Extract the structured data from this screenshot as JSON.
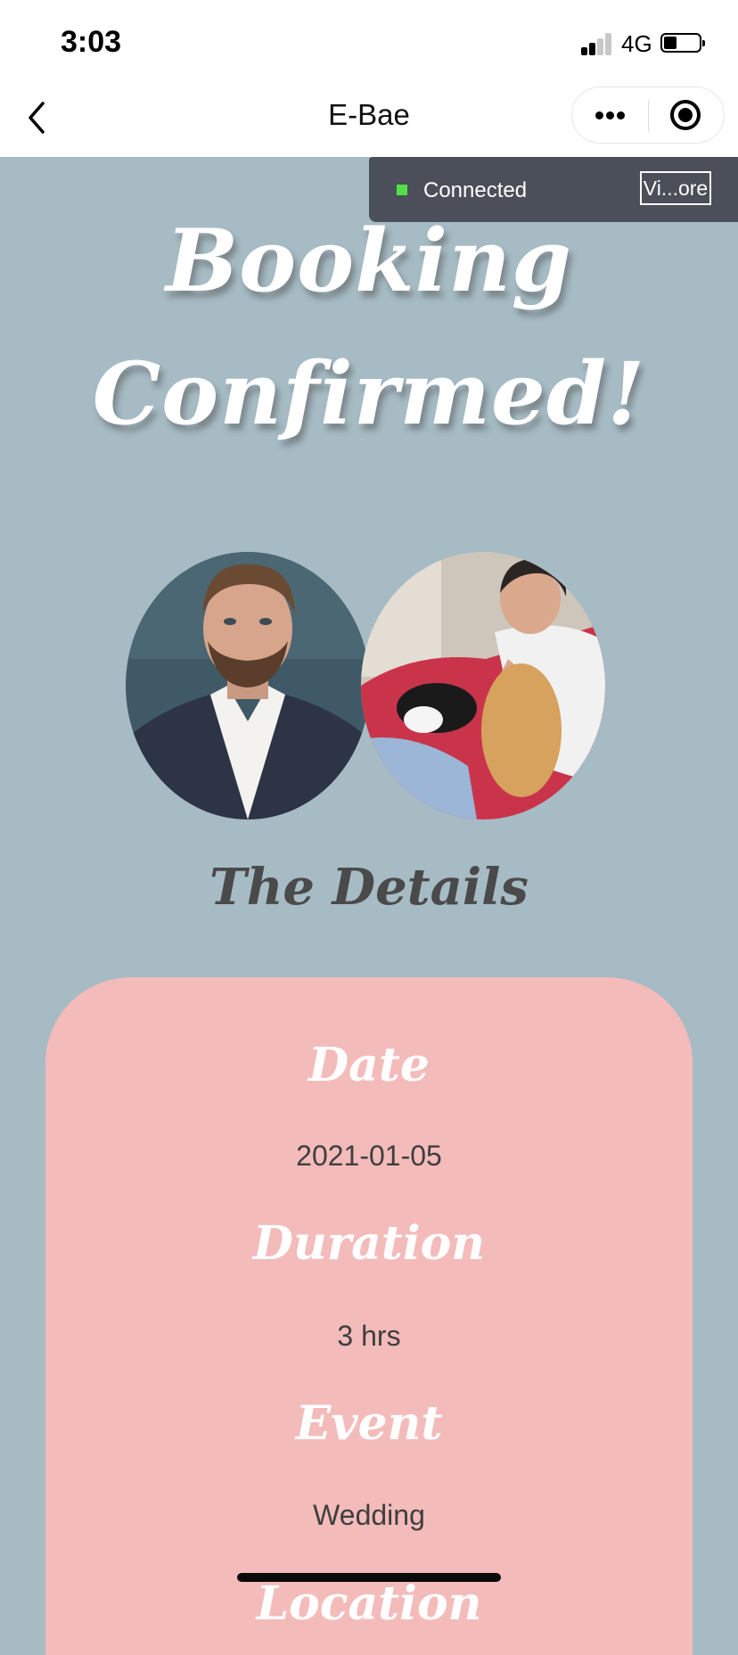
{
  "status_bar": {
    "time": "3:03",
    "network": "4G"
  },
  "nav": {
    "title": "E-Bae",
    "back_icon": "chevron-left-icon",
    "more_icon": "more-dots-icon",
    "close_icon": "target-circle-icon"
  },
  "connection": {
    "status_text": "Connected",
    "status_color": "#52e04a",
    "view_more_label": "Vi...ore"
  },
  "headline": {
    "line1": "Booking",
    "line2": "Confirmed!"
  },
  "details": {
    "title": "The Details",
    "date_label": "Date",
    "date_value": "2021-01-05",
    "duration_label": "Duration",
    "duration_value": "3 hrs",
    "event_label": "Event",
    "event_value": "Wedding",
    "location_label": "Location"
  },
  "colors": {
    "page_background": "#a6bbc4",
    "card_background": "#f4bbbb",
    "headline_text": "#ffffff",
    "details_title_text": "#4a4a4a"
  }
}
